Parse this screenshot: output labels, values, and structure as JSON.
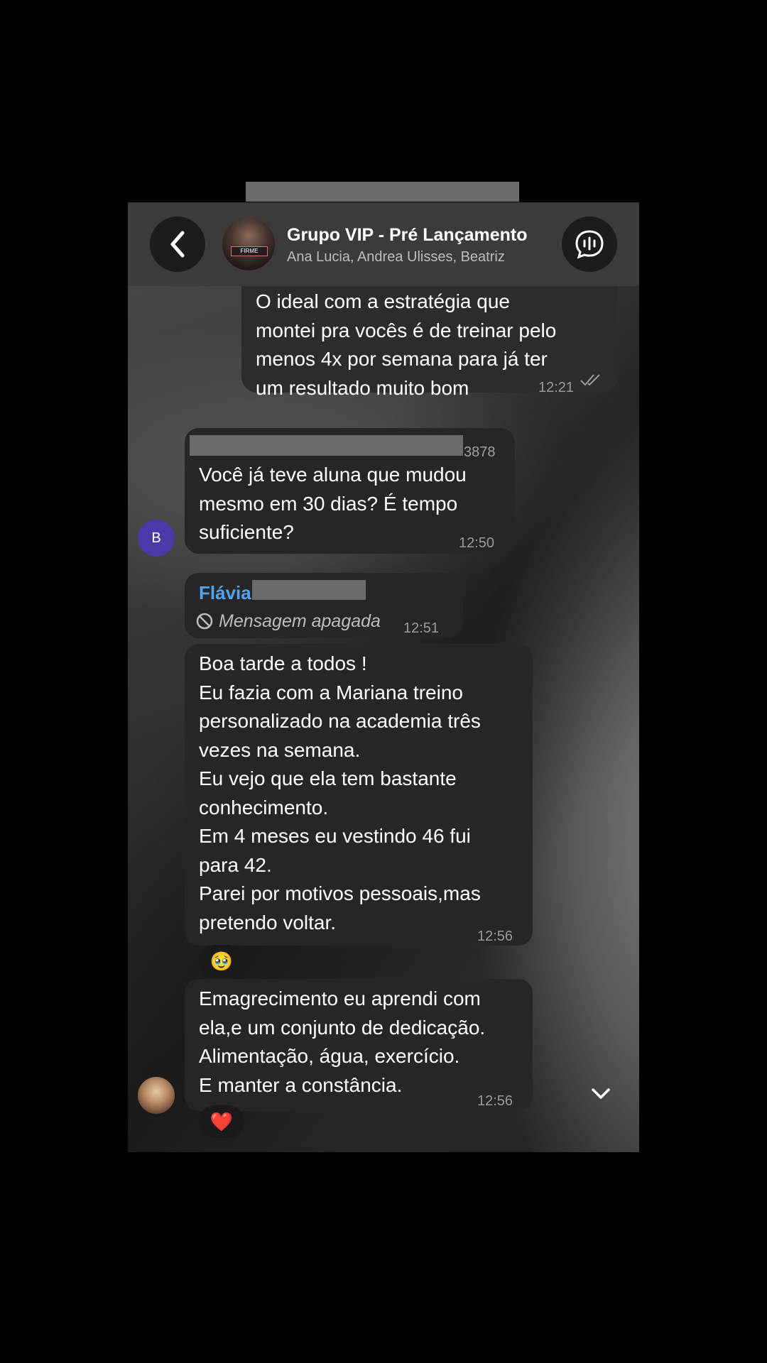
{
  "header": {
    "title": "Grupo VIP - Pré Lançamento",
    "members": "Ana Lucia, Andrea Ulisses, Beatriz",
    "avatar_text": "FIRME"
  },
  "messages": [
    {
      "text": "O ideal com a estratégia que\nmontei pra vocês é de treinar pelo\nmenos 4x por semana para já ter\num resultado muito bom",
      "time": "12:21",
      "status": "read"
    },
    {
      "sender_suffix": "3878",
      "text": "Você já teve aluna que mudou\nmesmo em 30 dias? É tempo\nsuficiente?",
      "time": "12:50",
      "avatar_letter": "B"
    },
    {
      "sender": "Flávia",
      "text": "Mensagem apagada",
      "time": "12:51"
    },
    {
      "text": "Boa tarde a todos !\nEu fazia com a Mariana treino\npersonalizado na academia três\nvezes na semana.\nEu vejo que ela tem bastante\nconhecimento.\nEm 4 meses eu vestindo 46 fui\npara 42.\nParei por motivos pessoais,mas\npretendo voltar.",
      "time": "12:56",
      "reaction": "🥹"
    },
    {
      "text": "Emagrecimento eu aprendi com\nela,e um conjunto de dedicação.\nAlimentação, água, exercício.\nE manter a constância.",
      "time": "12:56",
      "reaction": "❤️"
    }
  ],
  "icons": {
    "back": "chevron-left-icon",
    "info": "voice-chat-icon",
    "scroll": "chevron-down-icon",
    "deleted": "prohibited-icon"
  }
}
